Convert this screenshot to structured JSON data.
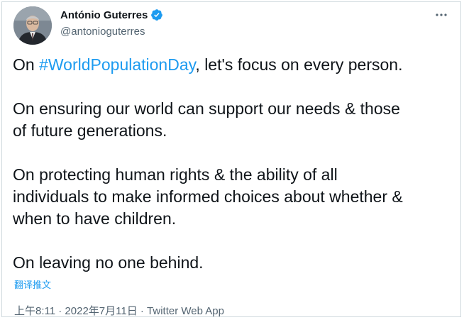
{
  "author": {
    "name": "António Guterres",
    "handle": "@antonioguterres",
    "verified": true,
    "verified_color": "#1d9bf0"
  },
  "menu_icon": "more-horizontal-icon",
  "tweet": {
    "line1_before": "On ",
    "line1_hashtag": "#WorldPopulationDay",
    "line1_after": ", let's focus on every person.",
    "para2_line1": "On ensuring our world can support our needs & those",
    "para2_line2": "of future generations.",
    "para3_line1": "On protecting human rights & the ability of all",
    "para3_line2": "individuals to make informed choices about whether &",
    "para3_line3": "when to have children.",
    "para4_line1": "On leaving no one behind."
  },
  "translate_label": "翻译推文",
  "timestamp": "上午8:11 · 2022年7月11日 · Twitter Web App",
  "colors": {
    "link": "#1d9bf0",
    "text": "#0f1419",
    "secondary": "#536471",
    "border": "#cfd9de"
  }
}
